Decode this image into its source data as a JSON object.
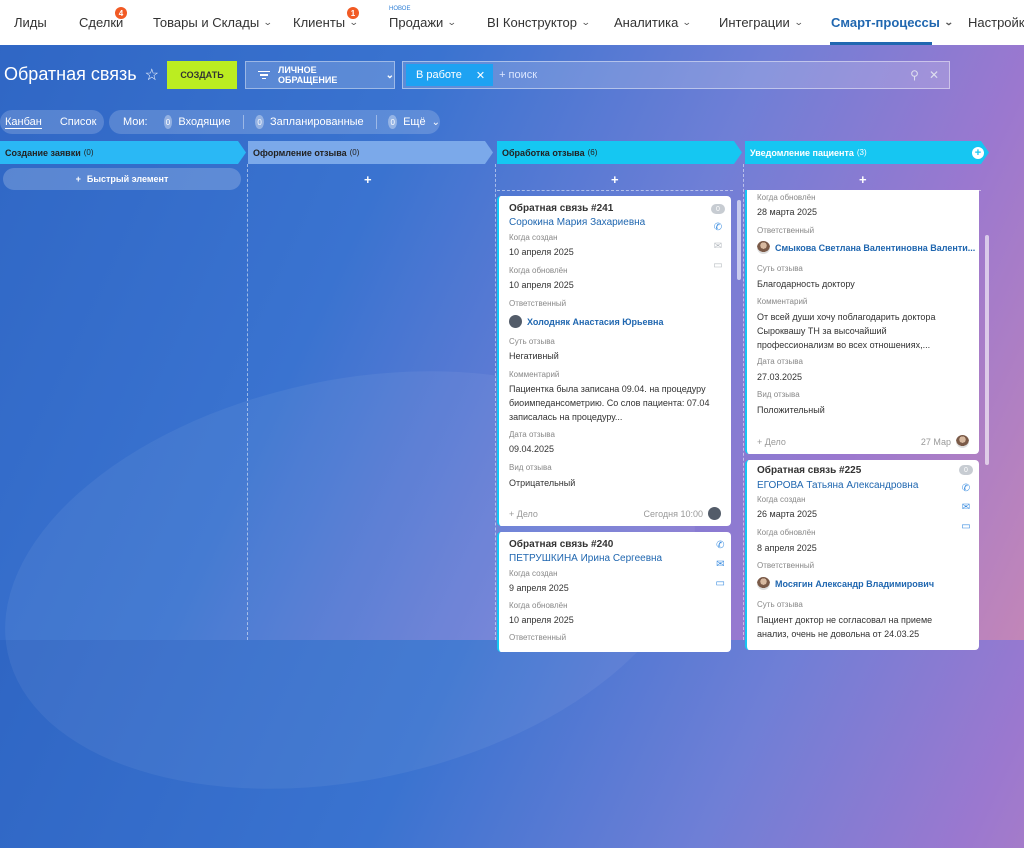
{
  "nav": {
    "items": [
      {
        "label": "Лиды"
      },
      {
        "label": "Сделки",
        "badge": "4"
      },
      {
        "label": "Товары и Склады"
      },
      {
        "label": "Клиенты",
        "badge": "1"
      },
      {
        "label": "Продажи",
        "tag": "НОВОЕ"
      },
      {
        "label": "BI Конструктор"
      },
      {
        "label": "Аналитика"
      },
      {
        "label": "Интеграции"
      },
      {
        "label": "Смарт-процессы"
      },
      {
        "label": "Настройки"
      }
    ]
  },
  "toolbar": {
    "title": "Обратная связь",
    "create": "СОЗДАТЬ",
    "filter": "ЛИЧНОЕ ОБРАЩЕНИЕ",
    "chip": "В работе",
    "search_placeholder": "+ поиск"
  },
  "views": {
    "kanban": "Канбан",
    "list": "Список"
  },
  "counters": {
    "mine": "Мои:",
    "incoming_count": "0",
    "incoming": "Входящие",
    "planned_count": "0",
    "planned": "Запланированные",
    "more_count": "0",
    "more": "Ещё"
  },
  "stages": [
    {
      "name": "Создание заявки",
      "count": "(0)"
    },
    {
      "name": "Оформление отзыва",
      "count": "(0)"
    },
    {
      "name": "Обработка отзыва",
      "count": "(6)"
    },
    {
      "name": "Уведомление пациента",
      "count": "(3)"
    }
  ],
  "quick_add": "Быстрый элемент",
  "plus": "+",
  "cards": {
    "c241": {
      "title": "Обратная связь #241",
      "name": "Сорокина Мария Захариевна",
      "zero": "0",
      "created_lbl": "Когда создан",
      "created": "10 апреля 2025",
      "updated_lbl": "Когда обновлён",
      "updated": "10 апреля 2025",
      "resp_lbl": "Ответственный",
      "resp": "Холодняк Анастасия Юрьевна",
      "essence_lbl": "Суть отзыва",
      "essence": "Негативный",
      "comment_lbl": "Комментарий",
      "comment1": "Пациентка была записана 09.04. на процедуру",
      "comment2": "биоимпедансометрию. Со слов пациента: 07.04",
      "comment3": "записалась на процедуру...",
      "date_lbl": "Дата отзыва",
      "date": "09.04.2025",
      "type_lbl": "Вид отзыва",
      "type": "Отрицательный",
      "deal": "+ Дело",
      "time": "Сегодня 10:00"
    },
    "c240": {
      "title": "Обратная связь #240",
      "name": "ПЕТРУШКИНА Ирина Сергеевна",
      "created_lbl": "Когда создан",
      "created": "9 апреля 2025",
      "updated_lbl": "Когда обновлён",
      "updated": "10 апреля 2025",
      "resp_lbl": "Ответственный"
    },
    "ctop": {
      "updated_lbl": "Когда обновлён",
      "updated": "28 марта 2025",
      "resp_lbl": "Ответственный",
      "resp": "Смыкова Светлана Валентиновна Валенти...",
      "essence_lbl": "Суть отзыва",
      "essence": "Благодарность доктору",
      "comment_lbl": "Комментарий",
      "comment1": "От всей души хочу поблагодарить доктора",
      "comment2": "Сыроквашу ТН за высочайший",
      "comment3": "профессионализм во всех отношениях,...",
      "date_lbl": "Дата отзыва",
      "date": "27.03.2025",
      "type_lbl": "Вид отзыва",
      "type": "Положительный",
      "deal": "+ Дело",
      "time": "27 Мар"
    },
    "c225": {
      "title": "Обратная связь #225",
      "name": "ЕГОРОВА Татьяна Александровна",
      "zero": "0",
      "created_lbl": "Когда создан",
      "created": "26 марта 2025",
      "updated_lbl": "Когда обновлён",
      "updated": "8 апреля 2025",
      "resp_lbl": "Ответственный",
      "resp": "Мосягин Александр Владимирович",
      "essence_lbl": "Суть отзыва",
      "comment1": "Пациент доктор не согласовал на приеме",
      "comment2": "анализ, очень не довольна от 24.03.25"
    }
  }
}
